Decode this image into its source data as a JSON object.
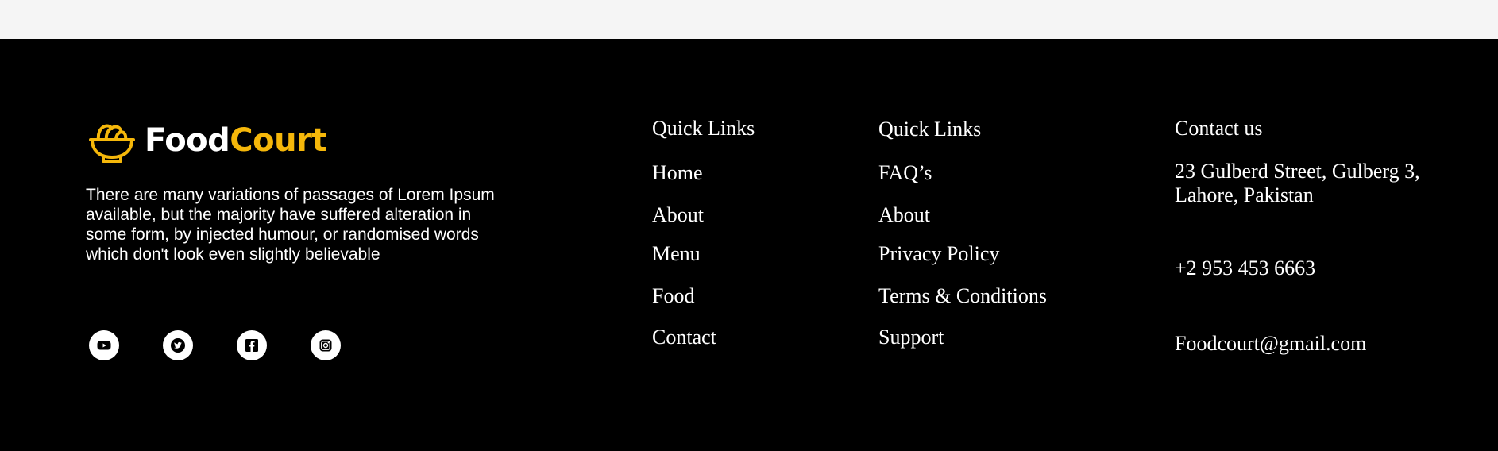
{
  "brand": {
    "name_part1": "Food",
    "name_part2": "Court",
    "accent_color": "#f5b70a",
    "icon": "food-bowl-icon"
  },
  "footer": {
    "description": "There are many variations of passages of Lorem Ipsum available, but the majority have suffered alteration in some form, by injected humour, or randomised words which don't look even slightly believable",
    "socials": [
      {
        "icon": "youtube-icon"
      },
      {
        "icon": "twitter-icon"
      },
      {
        "icon": "facebook-icon"
      },
      {
        "icon": "instagram-icon"
      }
    ],
    "quick_links_1": {
      "title": "Quick Links",
      "items": [
        "Home",
        "About",
        "Menu",
        "Food",
        "Contact"
      ]
    },
    "quick_links_2": {
      "title": "Quick Links",
      "items": [
        "FAQ’s",
        "About",
        "Privacy Policy",
        "Terms & Conditions",
        "Support"
      ]
    },
    "contact": {
      "title": "Contact us",
      "address_line1": "23 Gulberd Street, Gulberg 3,",
      "address_line2": "Lahore, Pakistan",
      "phone": "+2 953 453 6663",
      "email": "Foodcourt@gmail.com"
    }
  }
}
